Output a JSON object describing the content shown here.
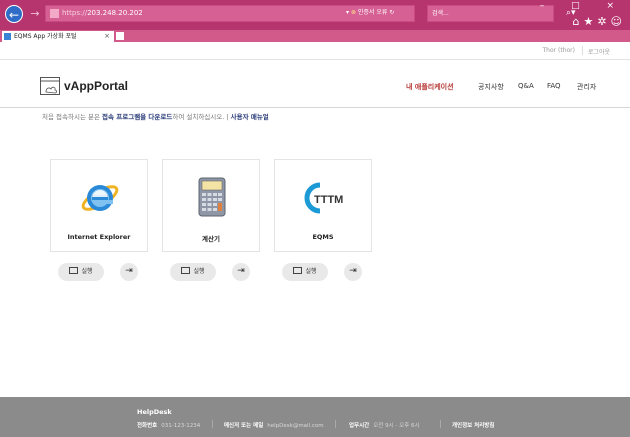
{
  "browser": {
    "address_scheme": "https://",
    "address_host": "203.248.20.202",
    "cert_error": "인증서 오류",
    "search_placeholder": "검색...",
    "tab_title": "EQMS App 가상화 포털",
    "tab_close": "×",
    "win_controls": "– □ ×",
    "toolbar_icons": "⌂★✲☺"
  },
  "util": {
    "user": "Thor (thor)",
    "logout": "로그아웃"
  },
  "header": {
    "brand": "vAppPortal",
    "nav": [
      "내 애플리케이션",
      "공지사항",
      "Q&A",
      "FAQ",
      "관리자"
    ]
  },
  "notice": {
    "prefix": "처음 접속하시는 분은 ",
    "link1": "접속 프로그램을 다운로드",
    "mid": "하여 설치하십시오. | ",
    "link2": "사용자 매뉴얼"
  },
  "apps": [
    {
      "name": "Internet Explorer",
      "icon": "internet-explorer-icon",
      "run_label": "실행"
    },
    {
      "name": "계산기",
      "icon": "calculator-icon",
      "run_label": "실행"
    },
    {
      "name": "EQMS",
      "icon": "ttm-icon",
      "run_label": "실행",
      "icon_text": "TTTM"
    }
  ],
  "footer": {
    "title": "HelpDesk",
    "phone_label": "전화번호",
    "phone": "031-123-1234",
    "email_label": "메신저 또는 메일",
    "email": "helpDesk@mail.com",
    "hours_label": "업무시간",
    "hours": "오전 9시 - 오후 6시",
    "privacy": "개인정보 처리방침"
  },
  "colors": {
    "browser_bar": "#b7356f",
    "accent_red": "#b63a39",
    "link_navy": "#2a3b78",
    "footer_bg": "#8b8b8b"
  }
}
